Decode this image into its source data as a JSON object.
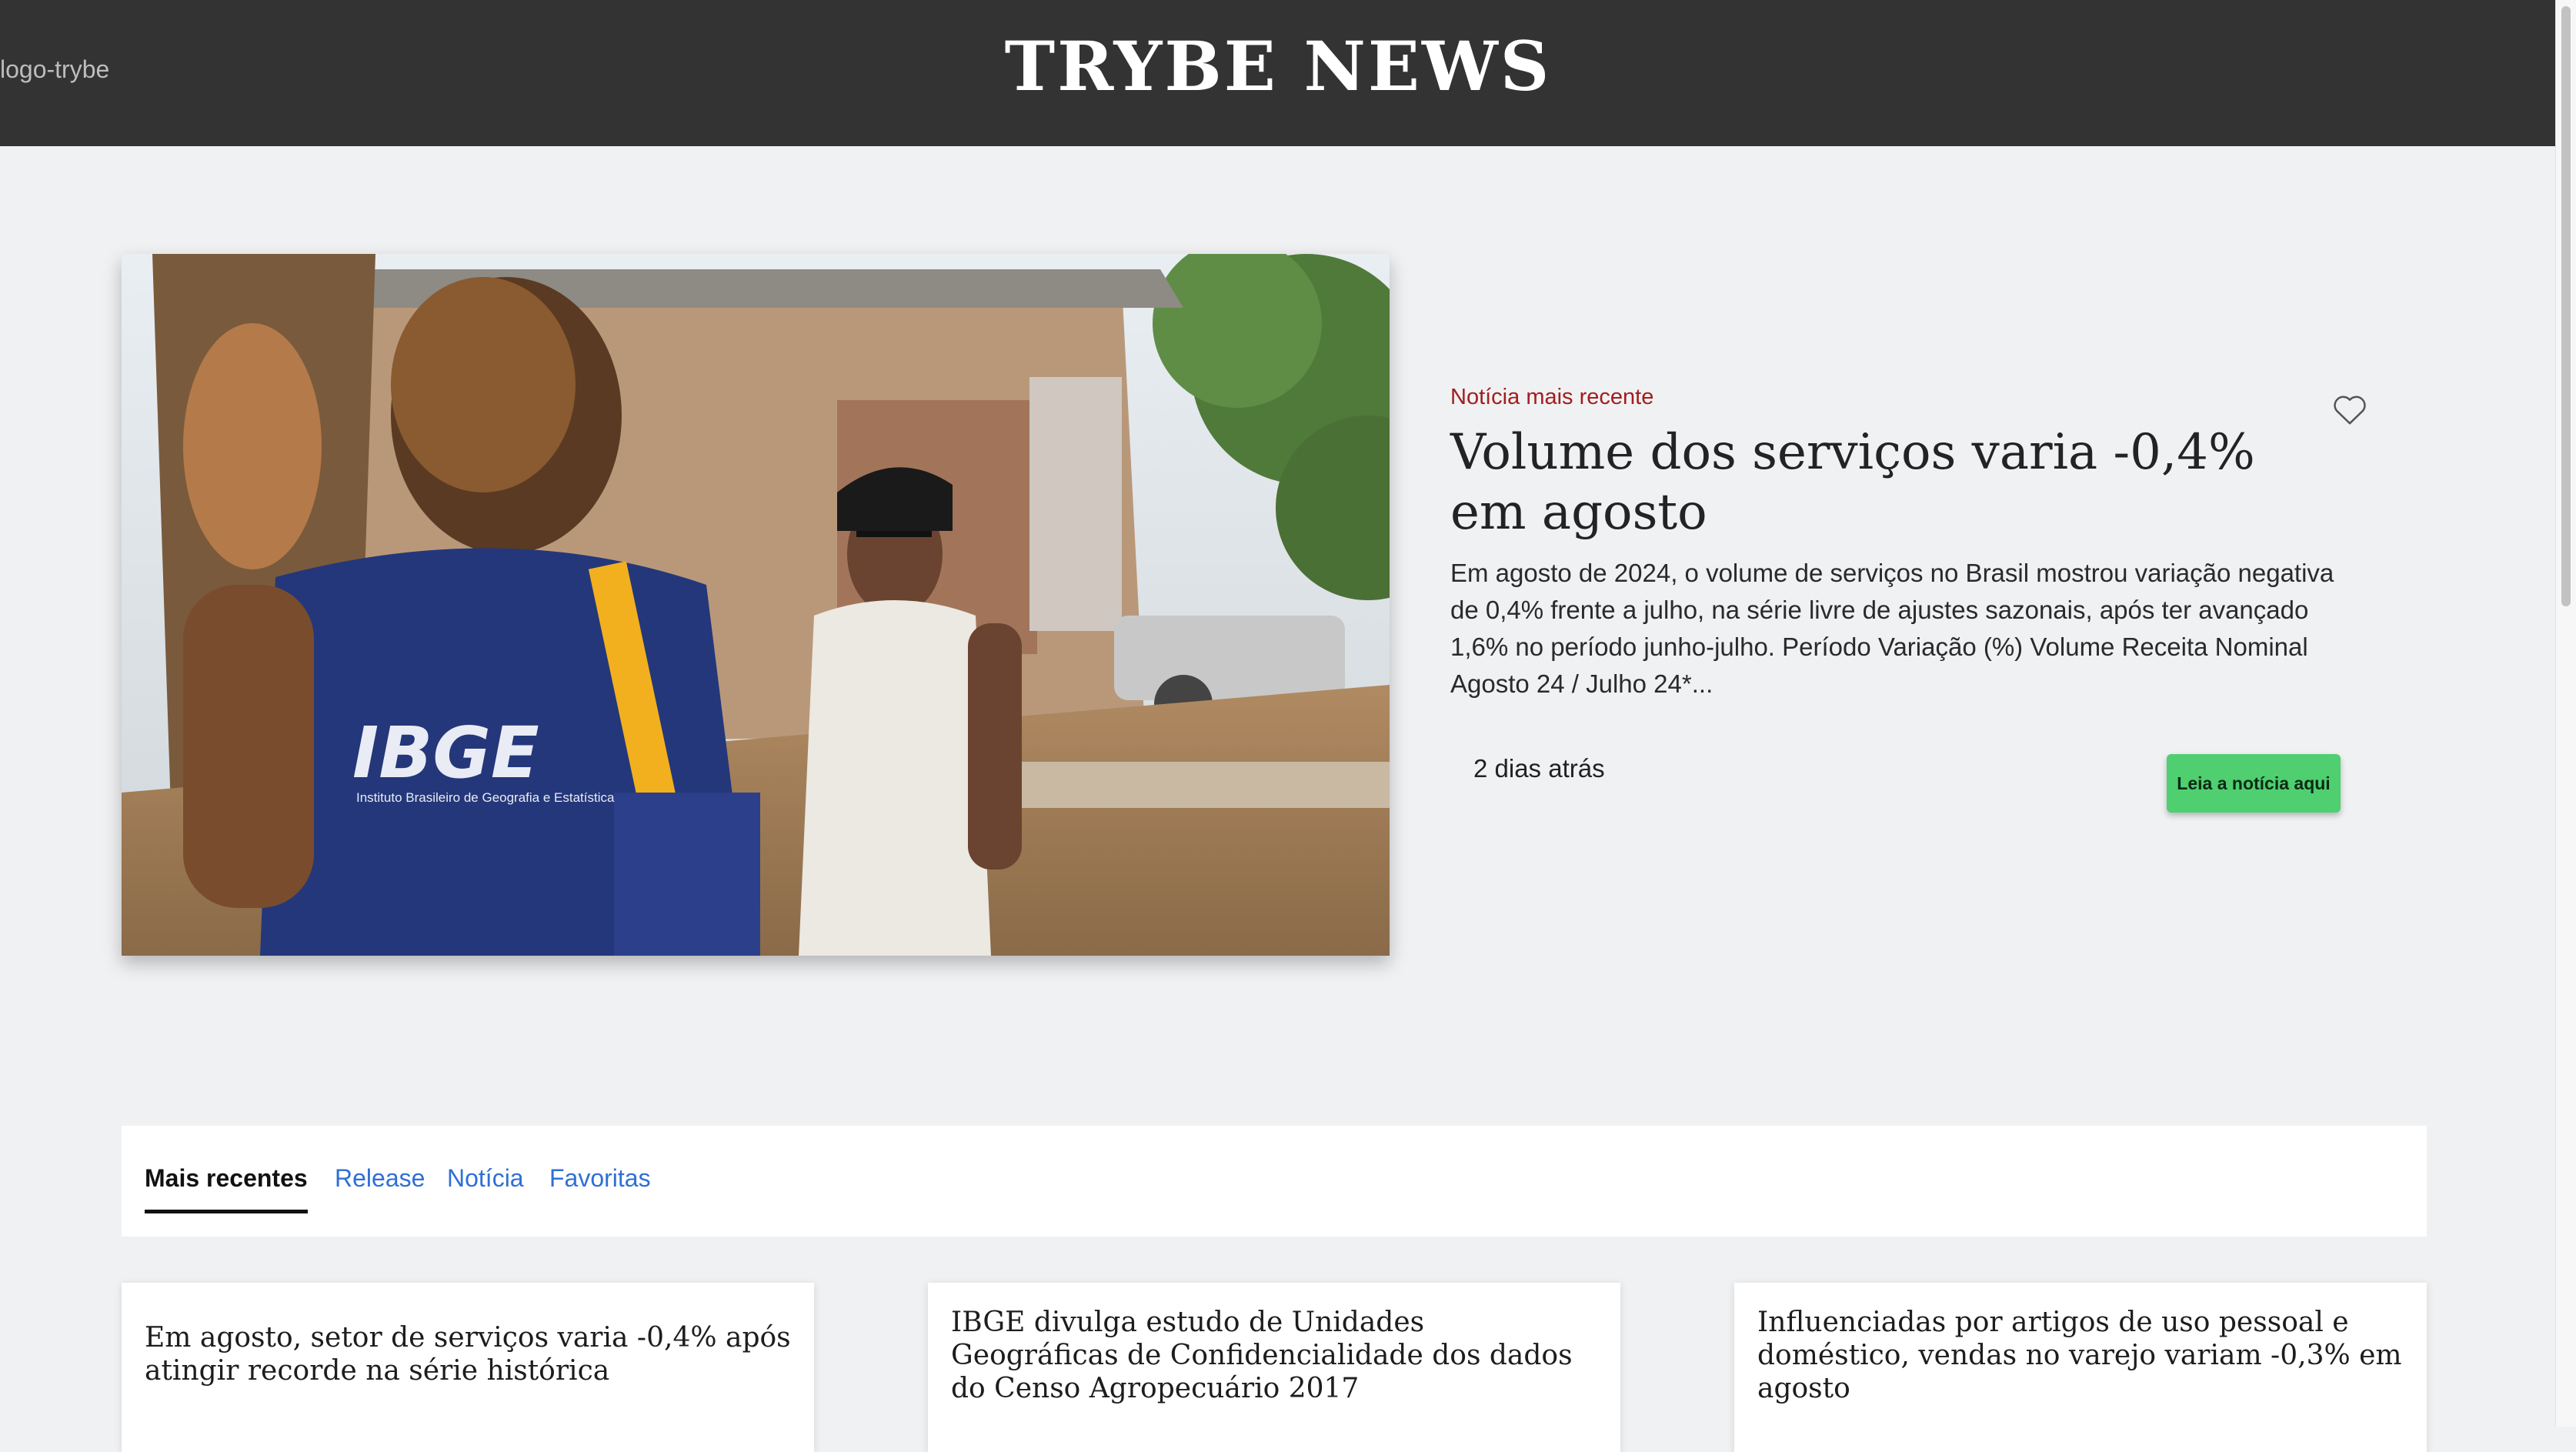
{
  "header": {
    "logo_alt": "logo-trybe",
    "title": "TRYBE NEWS"
  },
  "featured": {
    "label": "Notícia mais recente",
    "title": "Volume dos serviços varia -0,4% em agosto",
    "description": "Em agosto de 2024, o volume de serviços no Brasil mostrou variação negativa de 0,4% frente a julho, na série livre de ajustes sazonais, após ter avançado 1,6% no período junho-julho. Período Variação (%)  Volume  Receita Nominal Agosto 24 / Julho 24*...",
    "time": "2 dias atrás",
    "read_button": "Leia a notícia aqui",
    "image_text": {
      "brand": "IBGE",
      "subtitle": "Instituto Brasileiro de Geografia e Estatística"
    }
  },
  "tabs": [
    {
      "label": "Mais recentes",
      "active": true
    },
    {
      "label": "Release",
      "active": false
    },
    {
      "label": "Notícia",
      "active": false
    },
    {
      "label": "Favoritas",
      "active": false
    }
  ],
  "cards": [
    {
      "title": "Em agosto, setor de serviços varia -0,4% após atingir recorde na série histórica"
    },
    {
      "title": "IBGE divulga estudo de Unidades Geográficas de Confidencialidade dos dados do Censo Agropecuário 2017"
    },
    {
      "title": "Influenciadas por artigos de uso pessoal e doméstico, vendas no varejo variam -0,3% em agosto"
    }
  ],
  "colors": {
    "header_bg": "#333333",
    "label_red": "#a21d1d",
    "button_green": "#4fcf70",
    "tab_link": "#2f6fd6"
  }
}
